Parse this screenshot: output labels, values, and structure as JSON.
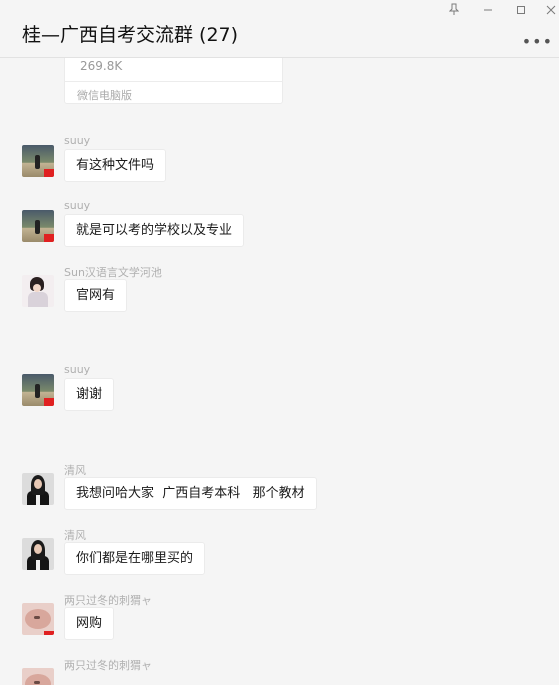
{
  "window": {
    "title": "桂—广西自考交流群 (27)",
    "pin_icon": "pin-icon",
    "minimize_icon": "minimize-icon",
    "maximize_icon": "maximize-icon",
    "close_icon": "close-icon",
    "more_icon": "more-horizontal-icon"
  },
  "file_card": {
    "size": "269.8K",
    "source": "微信电脑版"
  },
  "messages": [
    {
      "sender": "suuy",
      "text": "有这种文件吗",
      "avatar": "night-road-avatar"
    },
    {
      "sender": "suuy",
      "text": "就是可以考的学校以及专业",
      "avatar": "night-road-avatar"
    },
    {
      "sender": "Sun汉语言文学河池",
      "text": "官网有",
      "avatar": "girl-avatar"
    },
    {
      "sender": "suuy",
      "text": "谢谢",
      "avatar": "night-road-avatar"
    },
    {
      "sender": "清风",
      "text": "我想问哈大家  广西自考本科   那个教材",
      "avatar": "suit-woman-avatar"
    },
    {
      "sender": "清风",
      "text": "你们都是在哪里买的",
      "avatar": "suit-woman-avatar"
    },
    {
      "sender": "两只过冬的刺猬ャ",
      "text": "网购",
      "avatar": "hedgehog-avatar"
    },
    {
      "sender": "两只过冬的刺猬ャ",
      "text": "",
      "avatar": "hedgehog-avatar"
    }
  ],
  "colors": {
    "background": "#f5f5f5",
    "bubble": "#ffffff",
    "sender_name": "#b0b0b0"
  }
}
